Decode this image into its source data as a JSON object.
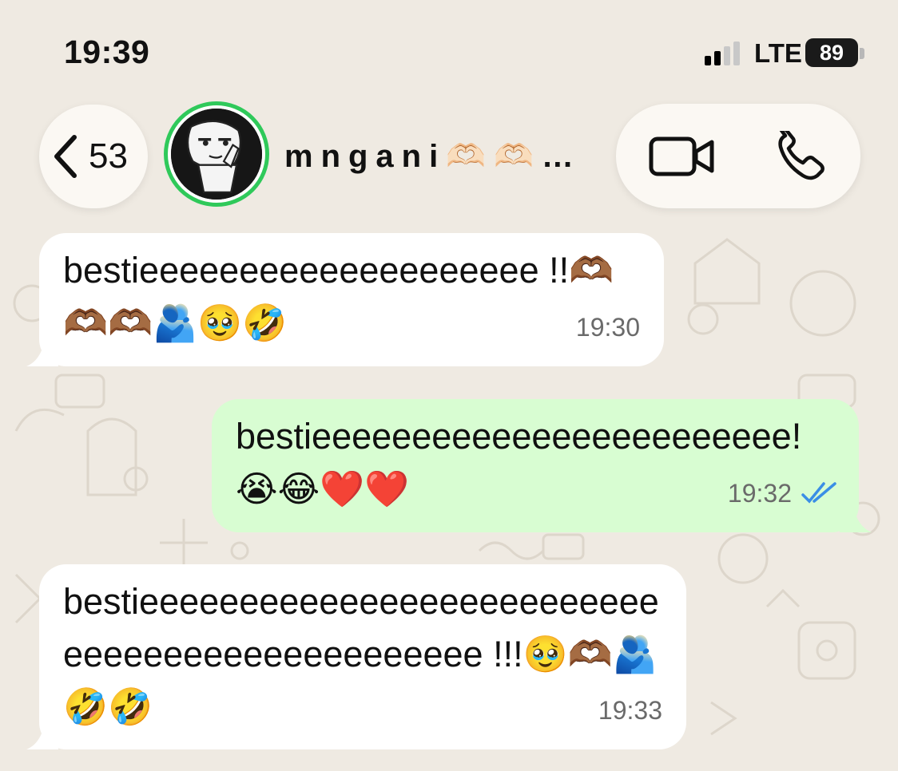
{
  "status_bar": {
    "time": "19:39",
    "network": "LTE",
    "battery": "89"
  },
  "header": {
    "back_count": "53",
    "contact_name": "mngani🫶🏻🫶🏻…",
    "avatar_ring_color": "#2fc95a"
  },
  "messages": [
    {
      "direction": "incoming",
      "text": "bestieeeeeeeeeeeeeeeeeeee !!🫶🏾🫶🏾🫶🏾🫂🥹🤣",
      "time": "19:30"
    },
    {
      "direction": "outgoing",
      "text": "bestieeeeeeeeeeeeeeeeeeeeeeee!😭😂❤️❤️",
      "time": "19:32",
      "status": "read"
    },
    {
      "direction": "incoming",
      "text": "bestieeeeeeeeeeeeeeeeeeeeeeeeeeeeeeeeeeeeeeeeeeeeeee !!!🥹🫶🏾🫂🤣🤣",
      "time": "19:33"
    }
  ],
  "colors": {
    "wallpaper": "#efeae2",
    "incoming_bubble": "#ffffff",
    "outgoing_bubble": "#d8fdd2",
    "read_ticks": "#3a8ee6"
  },
  "icons": [
    "back-chevron-icon",
    "video-call-icon",
    "phone-call-icon",
    "signal-icon",
    "battery-icon",
    "read-receipt-icon"
  ]
}
